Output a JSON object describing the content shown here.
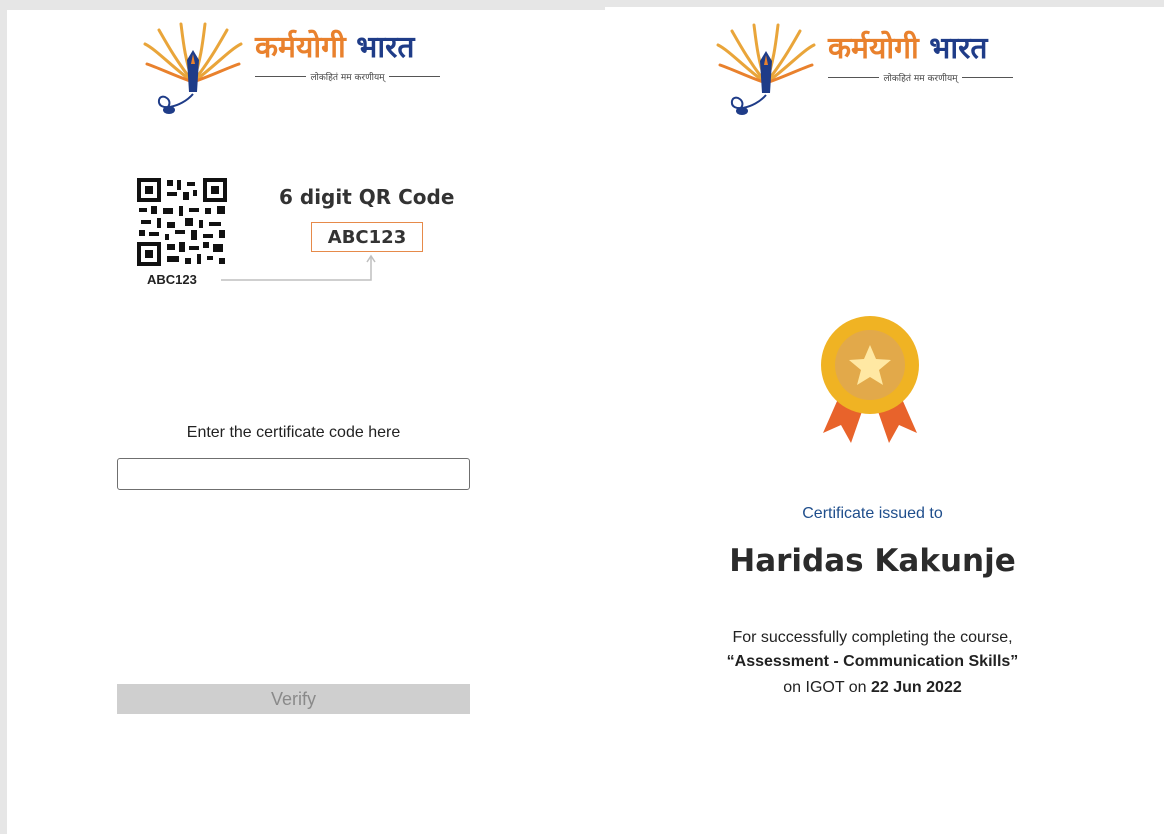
{
  "brand": {
    "title_part1": "कर्मयोगी",
    "title_part2": "भारत",
    "tagline": "लोकहितं मम करणीयम्",
    "colors": {
      "orange": "#e9812d",
      "navy": "#1f3c88"
    }
  },
  "verify_panel": {
    "qr_icon": "qr-code-icon",
    "qr_caption": "ABC123",
    "qr_title": "6 digit QR Code",
    "qr_code_example": "ABC123",
    "code_label": "Enter the certificate code here",
    "code_input_value": "",
    "code_input_placeholder": "",
    "verify_label": "Verify"
  },
  "certificate": {
    "medal_icon": "award-medal-icon",
    "issued_label": "Certificate issued to",
    "recipient": "Haridas Kakunje",
    "line1": "For successfully completing the course,",
    "course": "“Assessment - Communication Skills”",
    "line3_prefix": "on IGOT on",
    "date": "22 Jun 2022"
  }
}
